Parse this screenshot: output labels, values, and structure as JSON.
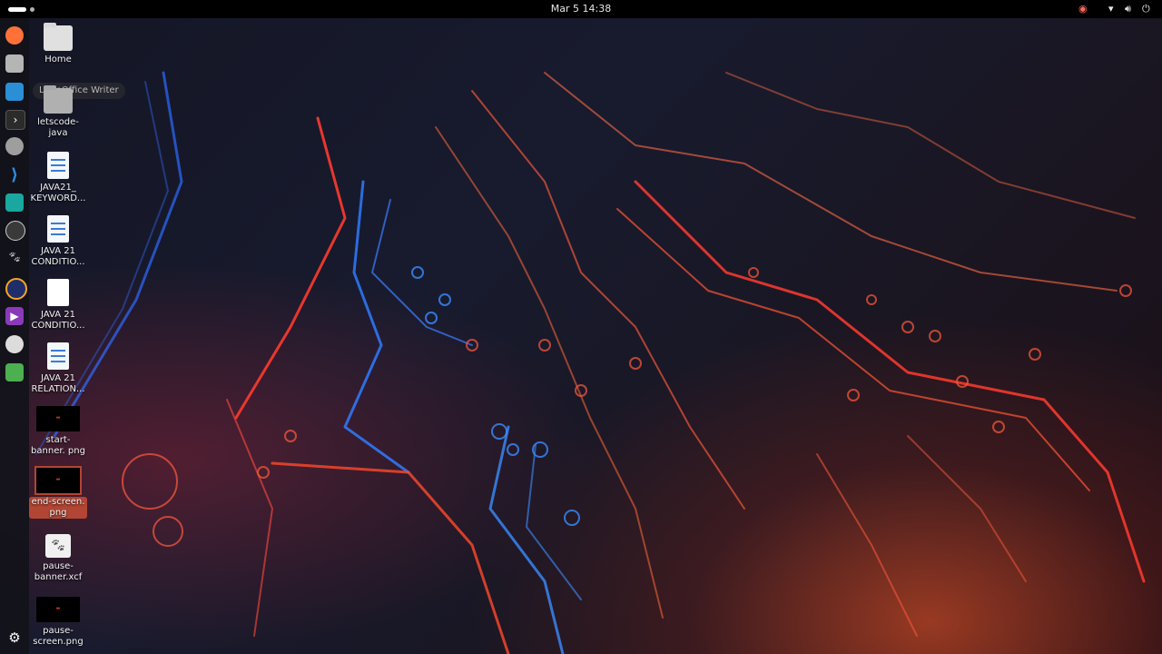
{
  "topbar": {
    "clock": "Mar 5  14:38",
    "tray_icons": [
      "network-wifi-icon",
      "volume-icon",
      "power-icon"
    ]
  },
  "dock": {
    "tooltip": "LibreOffice Writer",
    "items": [
      {
        "name": "firefox",
        "color": "#ff7139"
      },
      {
        "name": "files",
        "color": "#b0b0b0"
      },
      {
        "name": "libreoffice-writer",
        "color": "#2a8fd6"
      },
      {
        "name": "terminal",
        "color": "#2b2b2b"
      },
      {
        "name": "chat",
        "color": "#9e9e9e"
      },
      {
        "name": "vscode",
        "color": "#2d8fe3"
      },
      {
        "name": "intellij",
        "color": "#1aa7a0"
      },
      {
        "name": "obs",
        "color": "#3a3a3a"
      },
      {
        "name": "gimp",
        "color": "#8b7b6b"
      },
      {
        "name": "eclipse",
        "color": "#1f2d6b"
      },
      {
        "name": "media-player",
        "color": "#8a3ab9"
      },
      {
        "name": "disc",
        "color": "#dcdcdc"
      },
      {
        "name": "trash",
        "color": "#4caf50"
      }
    ],
    "apps_grid": "show-apps-icon"
  },
  "desktop": [
    {
      "label": "Home",
      "kind": "folder"
    },
    {
      "label": "letscode-java",
      "kind": "folder"
    },
    {
      "label": "JAVA21_ KEYWORD...",
      "kind": "doc"
    },
    {
      "label": "JAVA 21 CONDITIO...",
      "kind": "doc"
    },
    {
      "label": "JAVA 21 CONDITIO...",
      "kind": "page"
    },
    {
      "label": "JAVA 21 RELATION...",
      "kind": "doc"
    },
    {
      "label": "start-banner. png",
      "kind": "image"
    },
    {
      "label": "end-screen. png",
      "kind": "image"
    },
    {
      "label": "pause-banner.xcf",
      "kind": "xcf"
    },
    {
      "label": "pause-screen.png",
      "kind": "image"
    }
  ]
}
